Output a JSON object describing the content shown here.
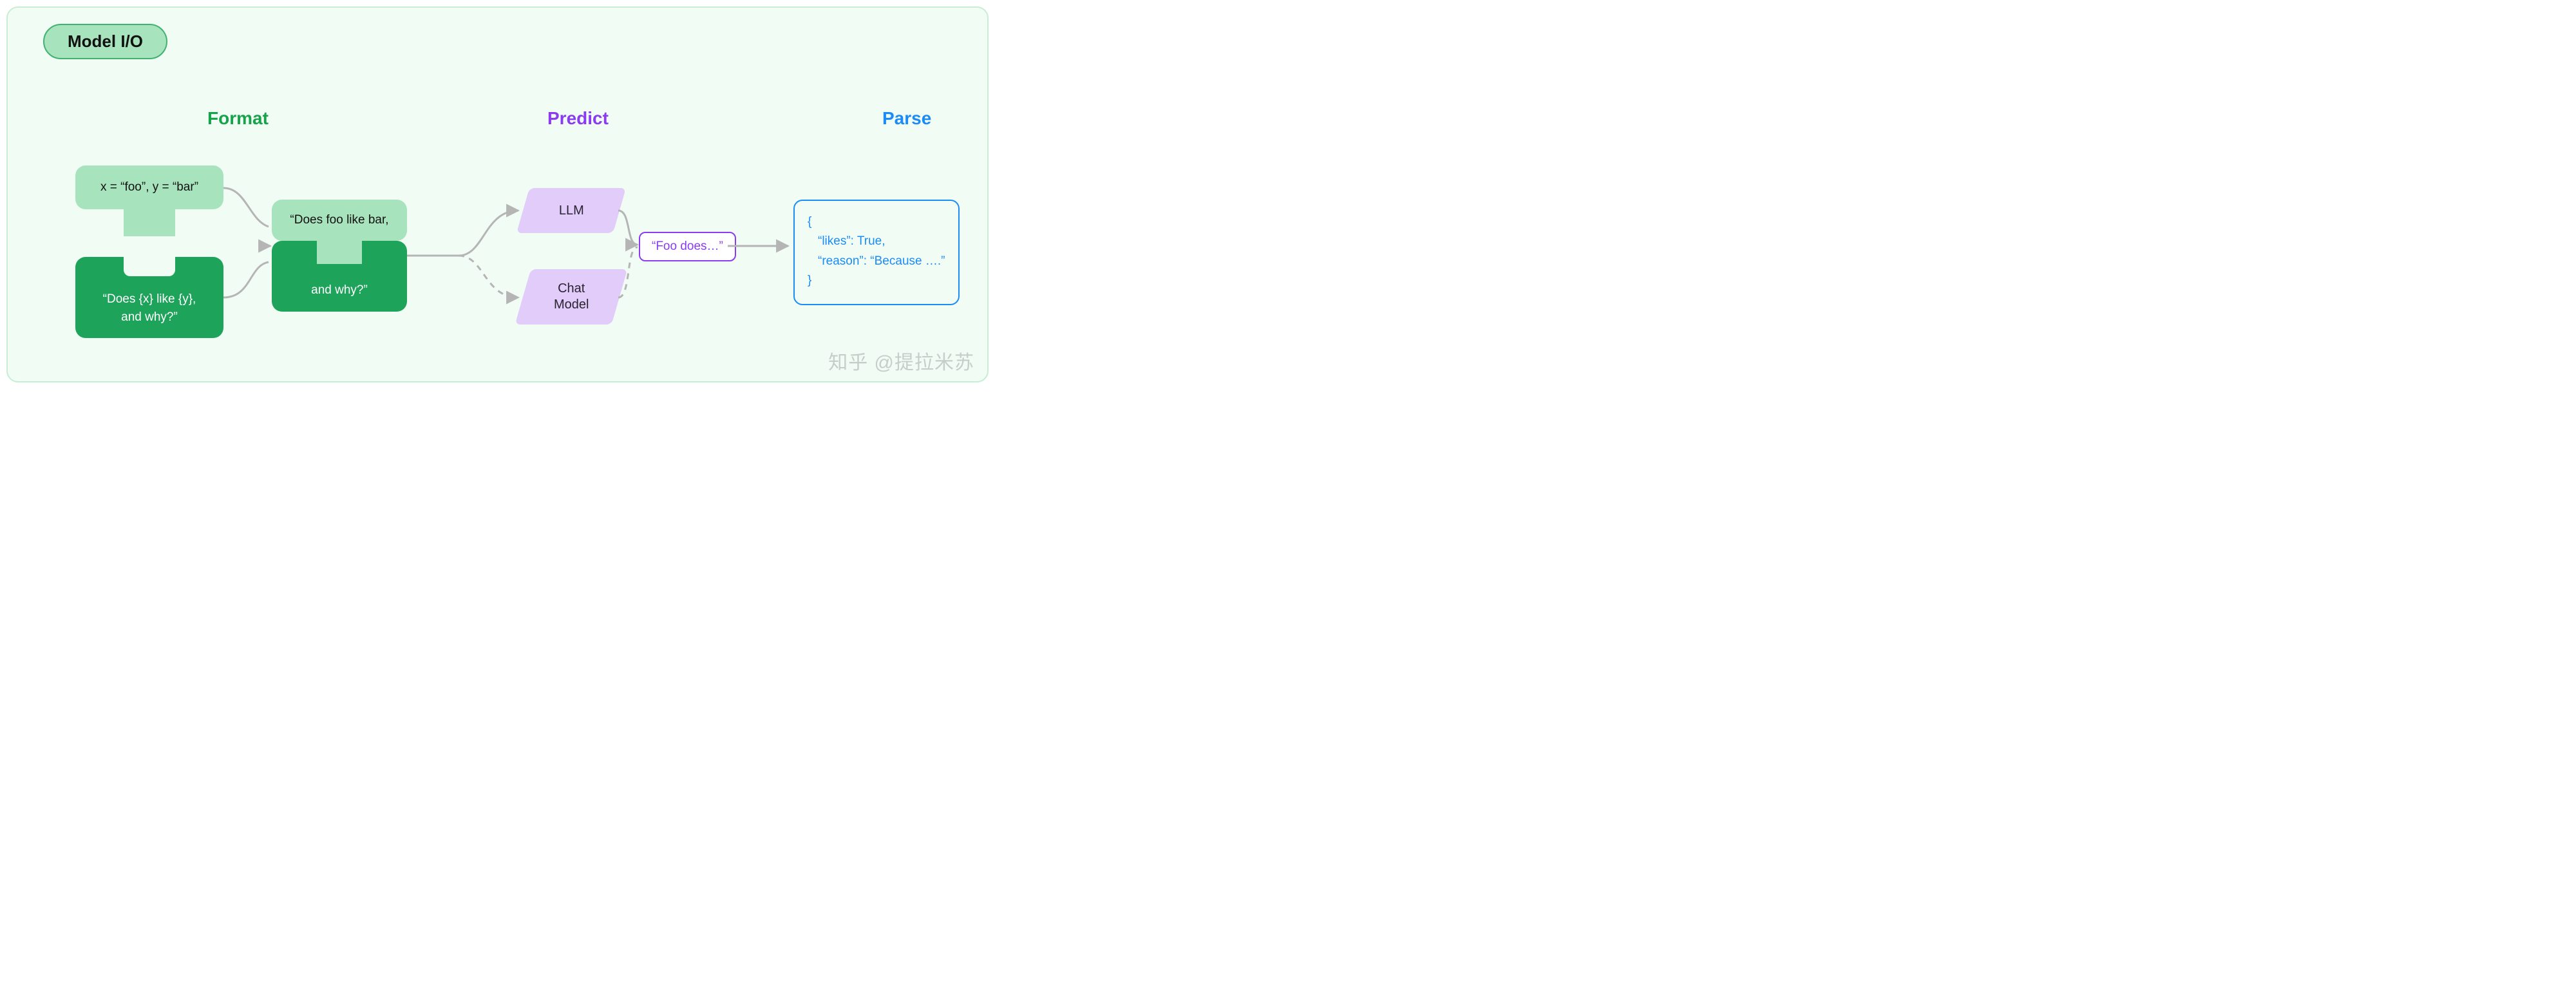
{
  "title": "Model I/O",
  "sections": {
    "format": {
      "label": "Format",
      "color": "#16a34a"
    },
    "predict": {
      "label": "Predict",
      "color": "#8b3cf0"
    },
    "parse": {
      "label": "Parse",
      "color": "#1b8cf5"
    }
  },
  "format": {
    "vars_text": "x = “foo”, y = “bar”",
    "template_line1": "“Does {x} like {y},",
    "template_line2": "and why?”",
    "filled_line1": "“Does foo like bar,",
    "filled_line2": "and why?”"
  },
  "predict": {
    "llm_label": "LLM",
    "chat_label_line1": "Chat",
    "chat_label_line2": "Model",
    "output_text": "“Foo does…”"
  },
  "parse": {
    "line1": "{",
    "line2": "“likes”: True,",
    "line3": "“reason”: “Because ….”",
    "line4": "}"
  },
  "watermark": "知乎 @提拉米苏"
}
